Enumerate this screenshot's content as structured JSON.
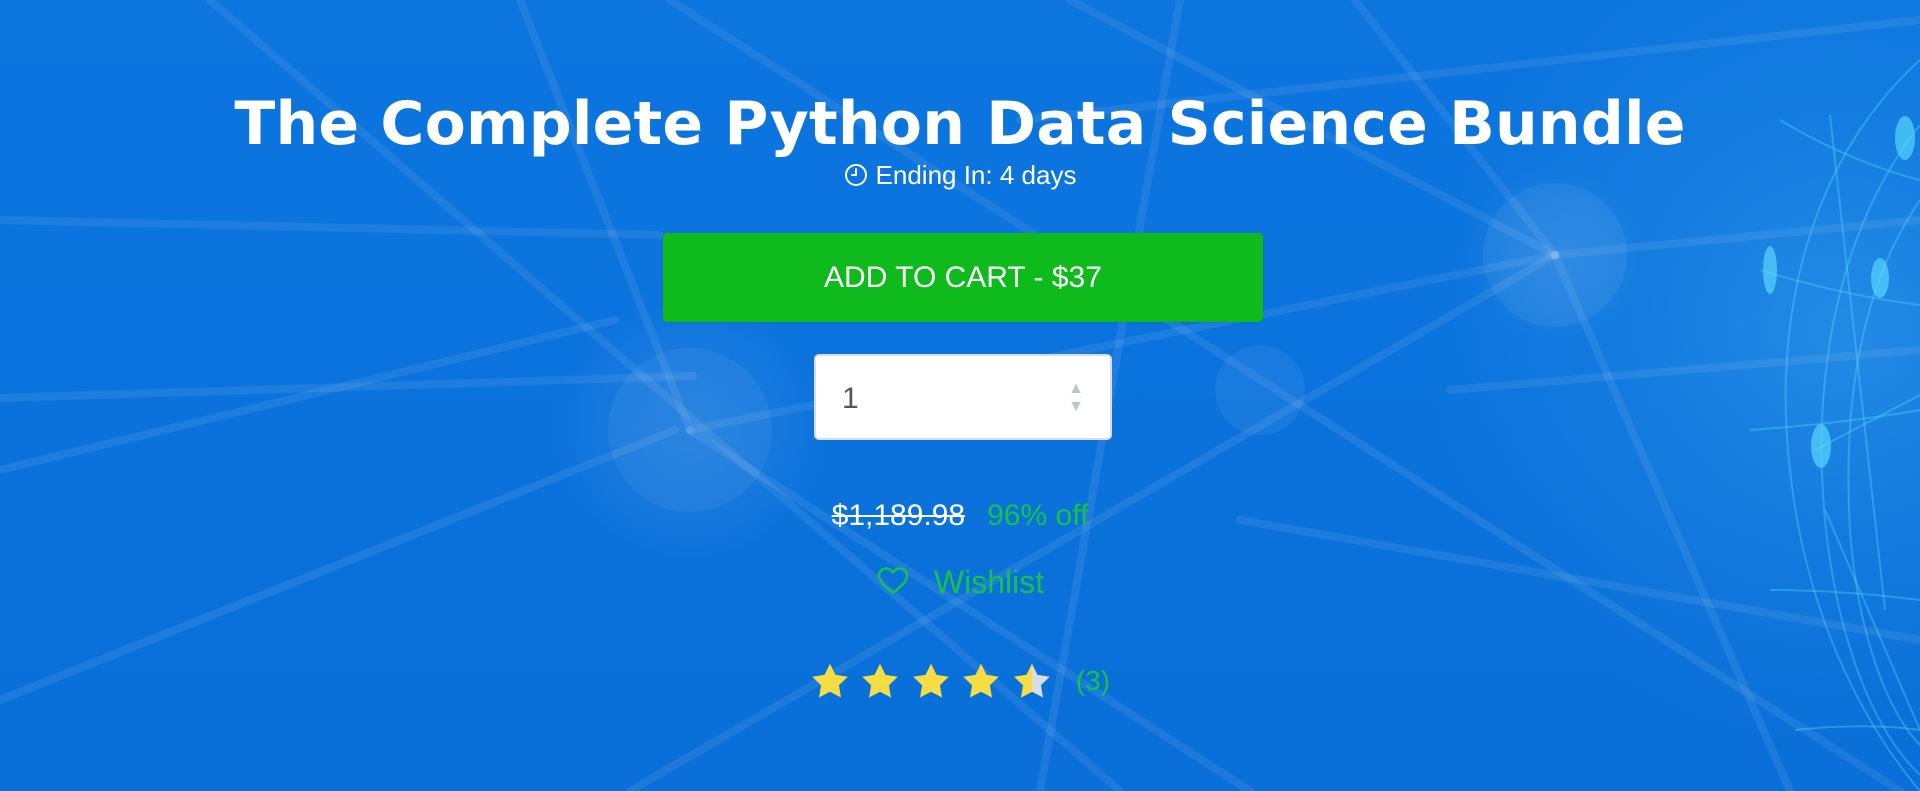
{
  "product": {
    "title": "The Complete Python Data Science Bundle",
    "ending_text": "Ending In: 4 days",
    "add_to_cart_label": "ADD TO CART - $37",
    "quantity": "1",
    "original_price": "$1,189.98",
    "discount_text": "96% off",
    "wishlist_label": "Wishlist",
    "rating": {
      "value": 4.5,
      "max": 5,
      "count_text": "(3)"
    }
  },
  "icons": {
    "clock": "clock-icon",
    "up_arrow": "chevron-up-icon",
    "down_arrow": "chevron-down-icon",
    "heart": "heart-icon",
    "star": "star-icon"
  },
  "colors": {
    "background": "#0b73dd",
    "title": "#ffffff",
    "button": "#0fba1d",
    "accent": "#18c24a",
    "star_fill": "#f5dd43",
    "star_empty": "#d7dde3"
  }
}
